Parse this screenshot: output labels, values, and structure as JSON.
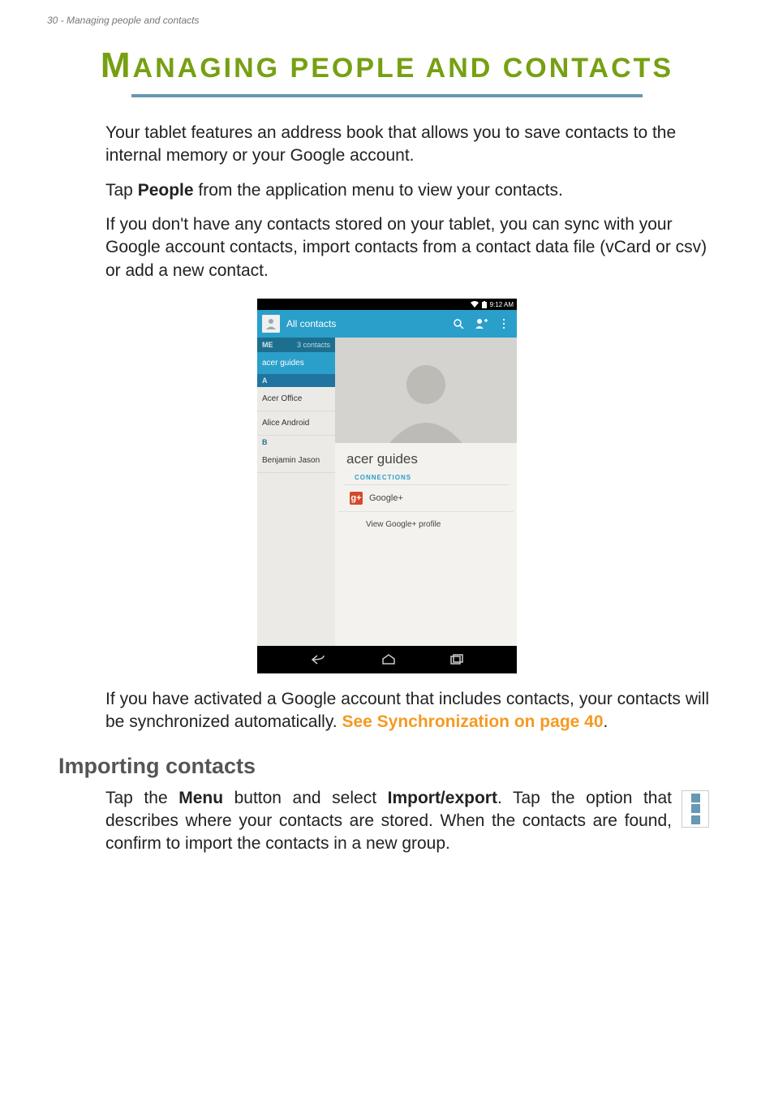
{
  "header": {
    "text": "30 - Managing people and contacts"
  },
  "heading": {
    "first_letter": "M",
    "rest": "ANAGING PEOPLE AND CONTACTS"
  },
  "intro": {
    "p1": "Your tablet features an address book that allows you to save contacts to the internal memory or your Google account.",
    "p2_pre": "Tap ",
    "p2_bold": "People",
    "p2_post": " from the application menu to view your contacts.",
    "p3": "If you don't have any contacts stored on your tablet, you can sync with your Google account contacts, import contacts from a contact data file (vCard or csv) or add a new contact."
  },
  "screenshot": {
    "status_time": "9:12 AM",
    "appbar_title": "All contacts",
    "sidebar": {
      "me_label": "ME",
      "me_count": "3 contacts",
      "selected": "acer guides",
      "section_a": "A",
      "items_a": [
        "Acer Office",
        "Alice Android"
      ],
      "section_b": "B",
      "items_b": [
        "Benjamin Jason"
      ]
    },
    "detail": {
      "name": "acer guides",
      "connections_label": "CONNECTIONS",
      "gplus_symbol": "g+",
      "gplus_text": "Google+",
      "view_profile": "View Google+ profile"
    }
  },
  "after_shot": {
    "pre": "If you have activated a Google account that includes contacts, your contacts will be synchronized automatically. ",
    "link": "See Synchronization on page 40",
    "post": "."
  },
  "section2": {
    "heading": "Importing contacts"
  },
  "import_para": {
    "t1": "Tap the ",
    "b1": "Menu",
    "t2": " button and select ",
    "b2": "Import/export",
    "t3": ". Tap the option that describes where your contacts are stored. When the contacts are found, confirm to import the contacts in a new group."
  }
}
